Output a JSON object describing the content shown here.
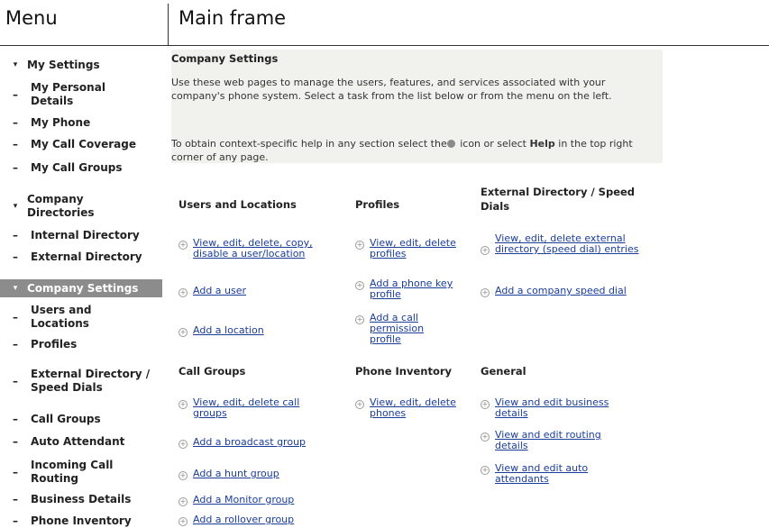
{
  "header": {
    "menu_label": "Menu",
    "main_label": "Main frame"
  },
  "menu": [
    {
      "marker": "▾",
      "label": "My Settings",
      "section": true
    },
    {
      "marker": "–",
      "label": "My Personal Details"
    },
    {
      "marker": "–",
      "label": "My Phone"
    },
    {
      "marker": "–",
      "label": "My Call Coverage"
    },
    {
      "marker": "–",
      "label": "My Call Groups"
    },
    {
      "marker": "▾",
      "label": "Company Directories",
      "section": true
    },
    {
      "marker": "–",
      "label": "Internal Directory"
    },
    {
      "marker": "–",
      "label": "External Directory"
    },
    {
      "marker": "▾",
      "label": "Company Settings",
      "section": true,
      "selected": true
    },
    {
      "marker": "–",
      "label": "Users and Locations"
    },
    {
      "marker": "–",
      "label": "Profiles"
    },
    {
      "marker": "–",
      "label": "External Directory / Speed Dials"
    },
    {
      "marker": "–",
      "label": "Call Groups"
    },
    {
      "marker": "–",
      "label": "Auto Attendant"
    },
    {
      "marker": "–",
      "label": "Incoming Call Routing"
    },
    {
      "marker": "–",
      "label": "Business Details"
    },
    {
      "marker": "–",
      "label": "Phone Inventory"
    }
  ],
  "intro": {
    "title": "Company Settings",
    "paragraph1": "Use these web pages to manage the users, features, and services associated with your company's phone system. Select a task from the list below or from the menu on the left.",
    "paragraph2_a": "To obtain context-specific help in any section select the",
    "paragraph2_b": " icon or select ",
    "paragraph2_help": "Help",
    "paragraph2_c": " in the top right corner of any page."
  },
  "sections": {
    "users_locations": {
      "title": "Users and Locations",
      "links": [
        "View, edit, delete, copy, disable a user/location",
        "Add a user",
        "Add a location"
      ]
    },
    "profiles": {
      "title": "Profiles",
      "links": [
        "View, edit, delete profiles",
        "Add a phone key profile",
        "Add a call permission profile"
      ]
    },
    "external_dir": {
      "title": "External Directory / Speed Dials",
      "links": [
        "View, edit, delete external directory (speed dial) entries",
        "Add a company speed dial"
      ]
    },
    "call_groups": {
      "title": "Call Groups",
      "links": [
        "View, edit, delete call groups",
        "Add a broadcast group",
        "Add a hunt group",
        "Add a Monitor group",
        "Add a rollover group"
      ]
    },
    "phone_inventory": {
      "title": "Phone Inventory",
      "links": [
        "View, edit, delete phones"
      ]
    },
    "general": {
      "title": "General",
      "links": [
        "View and edit business details",
        "View and edit routing details",
        "View and edit auto attendants"
      ]
    }
  }
}
